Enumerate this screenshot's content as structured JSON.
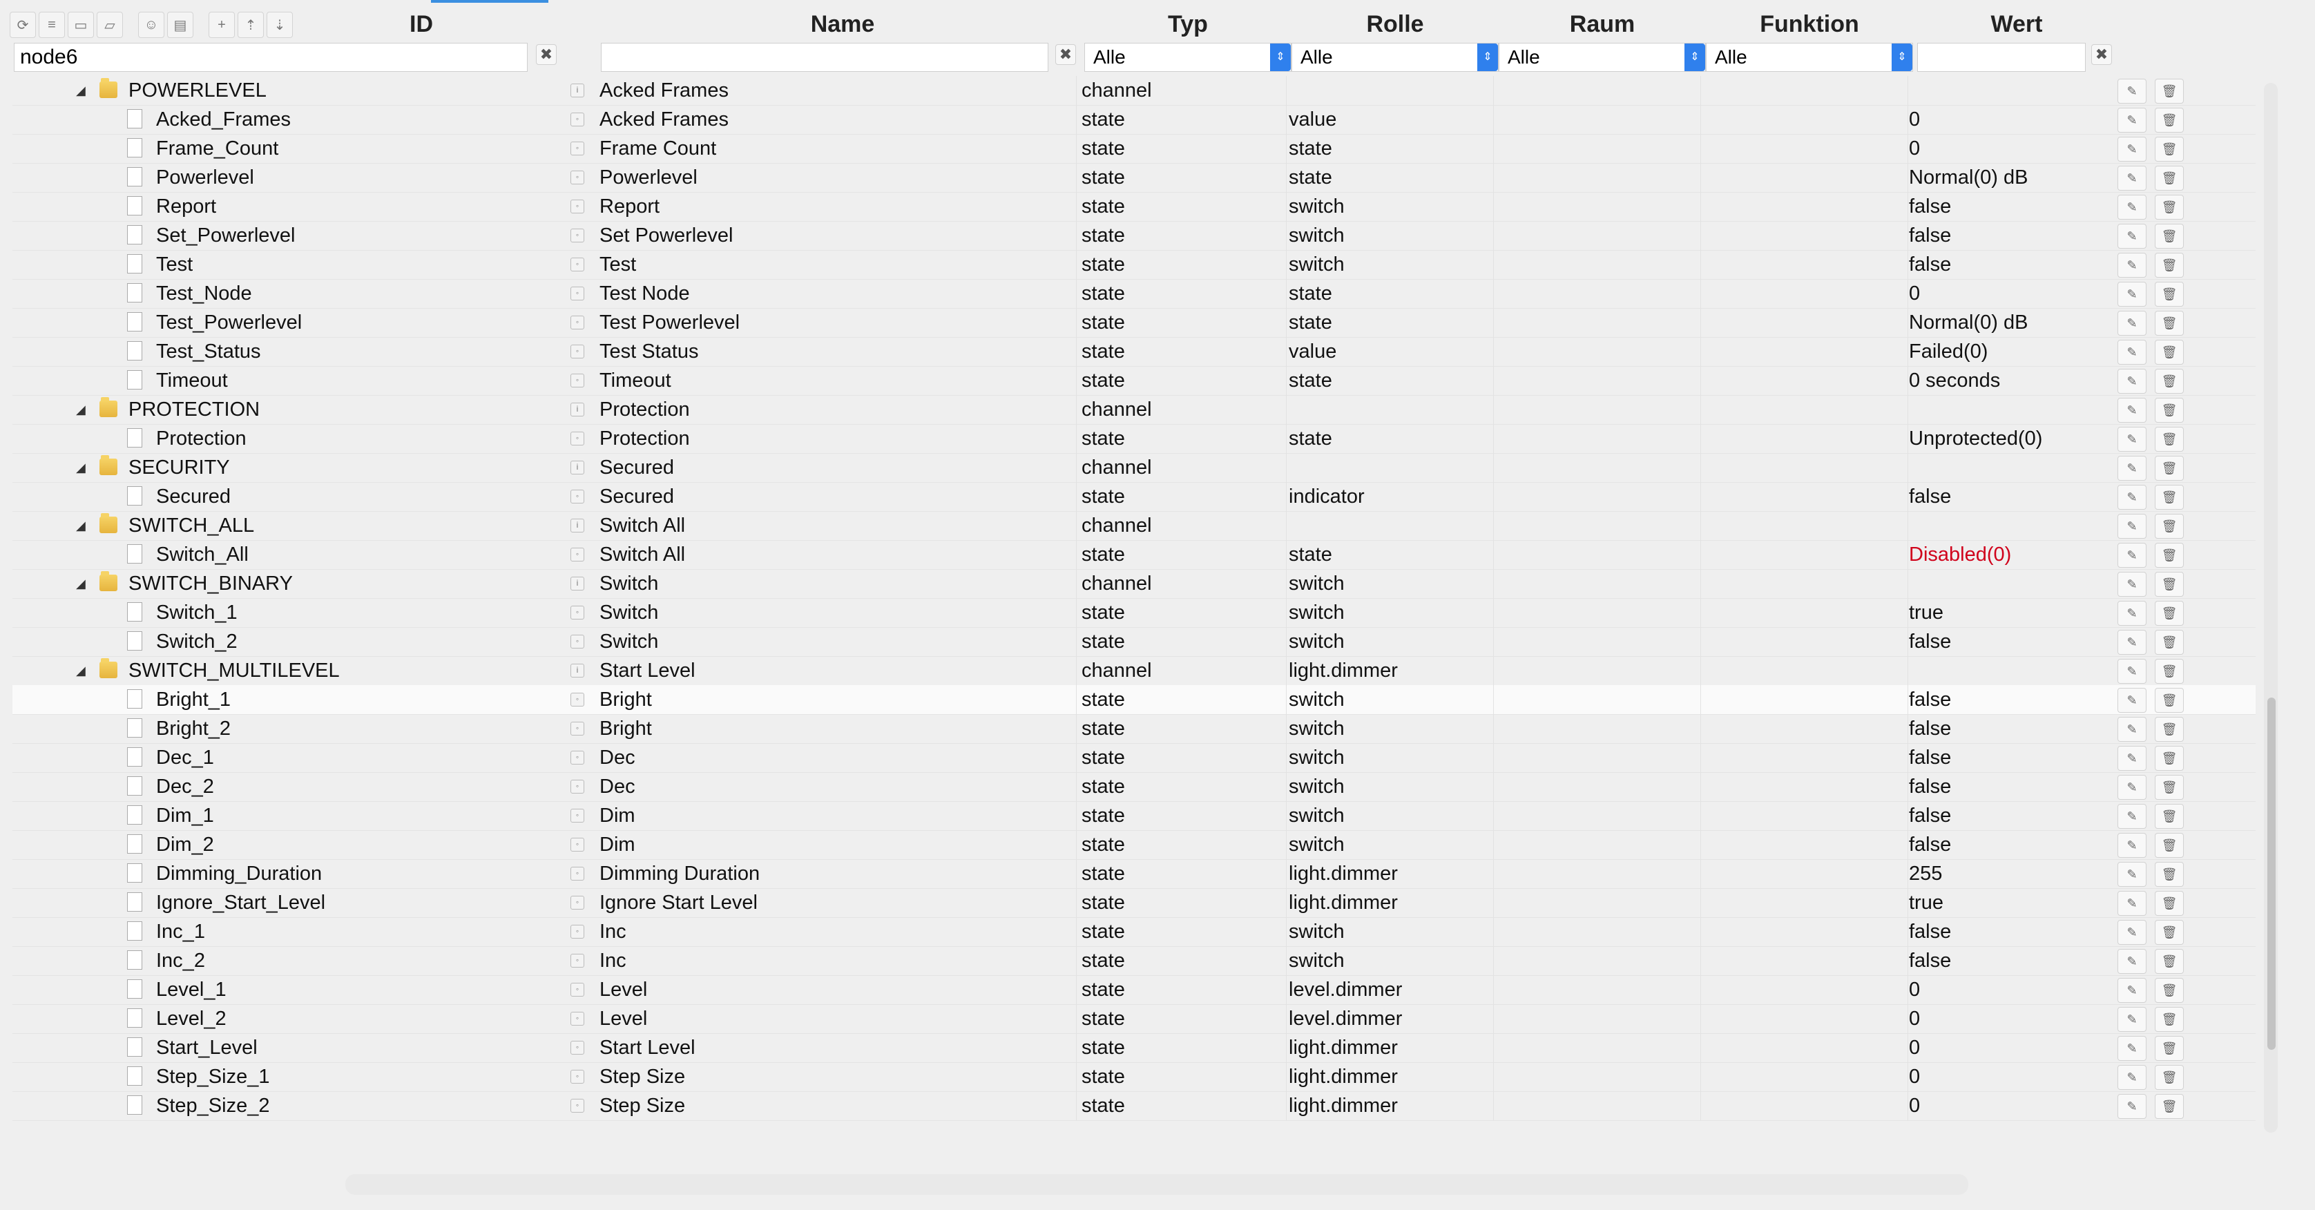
{
  "toolbar": {
    "icons": [
      "refresh-icon",
      "collapse-icon",
      "folder-icon",
      "folder-open-icon",
      "user-icon",
      "tag-icon",
      "add-icon",
      "upload-icon",
      "download-icon"
    ]
  },
  "headers": {
    "id": "ID",
    "name": "Name",
    "typ": "Typ",
    "rolle": "Rolle",
    "raum": "Raum",
    "funktion": "Funktion",
    "wert": "Wert"
  },
  "filters": {
    "id_value": "node6",
    "name_value": "",
    "typ": "Alle",
    "rolle": "Alle",
    "raum": "Alle",
    "funktion": "Alle",
    "wert_value": ""
  },
  "rows": [
    {
      "level": 1,
      "kind": "channel",
      "id": "POWERLEVEL",
      "name": "Acked Frames",
      "typ": "channel",
      "rolle": "",
      "wert": ""
    },
    {
      "level": 2,
      "kind": "state",
      "id": "Acked_Frames",
      "name": "Acked Frames",
      "typ": "state",
      "rolle": "value",
      "wert": "0"
    },
    {
      "level": 2,
      "kind": "state",
      "id": "Frame_Count",
      "name": "Frame Count",
      "typ": "state",
      "rolle": "state",
      "wert": "0"
    },
    {
      "level": 2,
      "kind": "state",
      "id": "Powerlevel",
      "name": "Powerlevel",
      "typ": "state",
      "rolle": "state",
      "wert": "Normal(0) dB"
    },
    {
      "level": 2,
      "kind": "state",
      "id": "Report",
      "name": "Report",
      "typ": "state",
      "rolle": "switch",
      "wert": "false"
    },
    {
      "level": 2,
      "kind": "state",
      "id": "Set_Powerlevel",
      "name": "Set Powerlevel",
      "typ": "state",
      "rolle": "switch",
      "wert": "false"
    },
    {
      "level": 2,
      "kind": "state",
      "id": "Test",
      "name": "Test",
      "typ": "state",
      "rolle": "switch",
      "wert": "false"
    },
    {
      "level": 2,
      "kind": "state",
      "id": "Test_Node",
      "name": "Test Node",
      "typ": "state",
      "rolle": "state",
      "wert": "0"
    },
    {
      "level": 2,
      "kind": "state",
      "id": "Test_Powerlevel",
      "name": "Test Powerlevel",
      "typ": "state",
      "rolle": "state",
      "wert": "Normal(0) dB"
    },
    {
      "level": 2,
      "kind": "state",
      "id": "Test_Status",
      "name": "Test Status",
      "typ": "state",
      "rolle": "value",
      "wert": "Failed(0)"
    },
    {
      "level": 2,
      "kind": "state",
      "id": "Timeout",
      "name": "Timeout",
      "typ": "state",
      "rolle": "state",
      "wert": "0 seconds"
    },
    {
      "level": 1,
      "kind": "channel",
      "id": "PROTECTION",
      "name": "Protection",
      "typ": "channel",
      "rolle": "",
      "wert": ""
    },
    {
      "level": 2,
      "kind": "state",
      "id": "Protection",
      "name": "Protection",
      "typ": "state",
      "rolle": "state",
      "wert": "Unprotected(0)"
    },
    {
      "level": 1,
      "kind": "channel",
      "id": "SECURITY",
      "name": "Secured",
      "typ": "channel",
      "rolle": "",
      "wert": ""
    },
    {
      "level": 2,
      "kind": "state",
      "id": "Secured",
      "name": "Secured",
      "typ": "state",
      "rolle": "indicator",
      "wert": "false"
    },
    {
      "level": 1,
      "kind": "channel",
      "id": "SWITCH_ALL",
      "name": "Switch All",
      "typ": "channel",
      "rolle": "",
      "wert": ""
    },
    {
      "level": 2,
      "kind": "state",
      "id": "Switch_All",
      "name": "Switch All",
      "typ": "state",
      "rolle": "state",
      "wert": "Disabled(0)",
      "wert_color": "#d0021b"
    },
    {
      "level": 1,
      "kind": "channel",
      "id": "SWITCH_BINARY",
      "name": "Switch",
      "typ": "channel",
      "rolle": "switch",
      "wert": ""
    },
    {
      "level": 2,
      "kind": "state",
      "id": "Switch_1",
      "name": "Switch",
      "typ": "state",
      "rolle": "switch",
      "wert": "true"
    },
    {
      "level": 2,
      "kind": "state",
      "id": "Switch_2",
      "name": "Switch",
      "typ": "state",
      "rolle": "switch",
      "wert": "false"
    },
    {
      "level": 1,
      "kind": "channel",
      "id": "SWITCH_MULTILEVEL",
      "name": "Start Level",
      "typ": "channel",
      "rolle": "light.dimmer",
      "wert": ""
    },
    {
      "level": 2,
      "kind": "state",
      "id": "Bright_1",
      "name": "Bright",
      "typ": "state",
      "rolle": "switch",
      "wert": "false",
      "highlight": true
    },
    {
      "level": 2,
      "kind": "state",
      "id": "Bright_2",
      "name": "Bright",
      "typ": "state",
      "rolle": "switch",
      "wert": "false"
    },
    {
      "level": 2,
      "kind": "state",
      "id": "Dec_1",
      "name": "Dec",
      "typ": "state",
      "rolle": "switch",
      "wert": "false"
    },
    {
      "level": 2,
      "kind": "state",
      "id": "Dec_2",
      "name": "Dec",
      "typ": "state",
      "rolle": "switch",
      "wert": "false"
    },
    {
      "level": 2,
      "kind": "state",
      "id": "Dim_1",
      "name": "Dim",
      "typ": "state",
      "rolle": "switch",
      "wert": "false"
    },
    {
      "level": 2,
      "kind": "state",
      "id": "Dim_2",
      "name": "Dim",
      "typ": "state",
      "rolle": "switch",
      "wert": "false"
    },
    {
      "level": 2,
      "kind": "state",
      "id": "Dimming_Duration",
      "name": "Dimming Duration",
      "typ": "state",
      "rolle": "light.dimmer",
      "wert": "255"
    },
    {
      "level": 2,
      "kind": "state",
      "id": "Ignore_Start_Level",
      "name": "Ignore Start Level",
      "typ": "state",
      "rolle": "light.dimmer",
      "wert": "true"
    },
    {
      "level": 2,
      "kind": "state",
      "id": "Inc_1",
      "name": "Inc",
      "typ": "state",
      "rolle": "switch",
      "wert": "false"
    },
    {
      "level": 2,
      "kind": "state",
      "id": "Inc_2",
      "name": "Inc",
      "typ": "state",
      "rolle": "switch",
      "wert": "false"
    },
    {
      "level": 2,
      "kind": "state",
      "id": "Level_1",
      "name": "Level",
      "typ": "state",
      "rolle": "level.dimmer",
      "wert": "0"
    },
    {
      "level": 2,
      "kind": "state",
      "id": "Level_2",
      "name": "Level",
      "typ": "state",
      "rolle": "level.dimmer",
      "wert": "0"
    },
    {
      "level": 2,
      "kind": "state",
      "id": "Start_Level",
      "name": "Start Level",
      "typ": "state",
      "rolle": "light.dimmer",
      "wert": "0"
    },
    {
      "level": 2,
      "kind": "state",
      "id": "Step_Size_1",
      "name": "Step Size",
      "typ": "state",
      "rolle": "light.dimmer",
      "wert": "0"
    },
    {
      "level": 2,
      "kind": "state",
      "id": "Step_Size_2",
      "name": "Step Size",
      "typ": "state",
      "rolle": "light.dimmer",
      "wert": "0"
    }
  ]
}
